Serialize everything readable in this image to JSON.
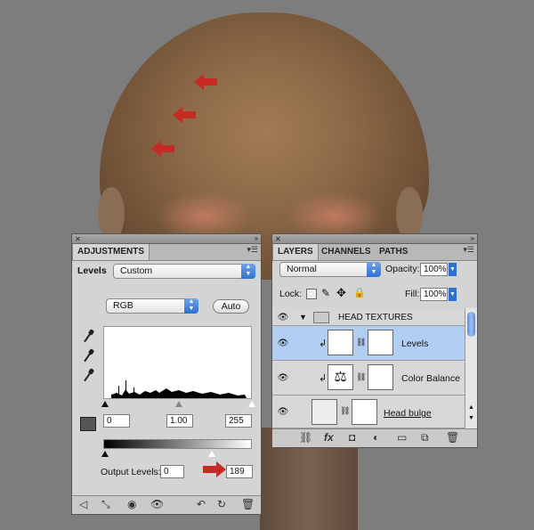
{
  "adjustments": {
    "tab_label": "ADJUSTMENTS",
    "preset_label": "Levels",
    "preset_value": "Custom",
    "channel_value": "RGB",
    "auto_label": "Auto",
    "input_black": "0",
    "input_gamma": "1.00",
    "input_white": "255",
    "output_label": "Output Levels:",
    "output_black": "0",
    "output_white": "189"
  },
  "layers": {
    "tabs": [
      "LAYERS",
      "CHANNELS",
      "PATHS"
    ],
    "blend_mode": "Normal",
    "opacity_label": "Opacity:",
    "opacity_value": "100%",
    "lock_label": "Lock:",
    "fill_label": "Fill:",
    "fill_value": "100%",
    "items": [
      {
        "name": "HEAD TEXTURES"
      },
      {
        "name": "Levels"
      },
      {
        "name": "Color Balance"
      },
      {
        "name": "Head bulge"
      }
    ]
  },
  "colors": {
    "accent_red": "#c62a22",
    "selection_blue": "#b2cff3",
    "select_blue": "#2f6fd0"
  }
}
